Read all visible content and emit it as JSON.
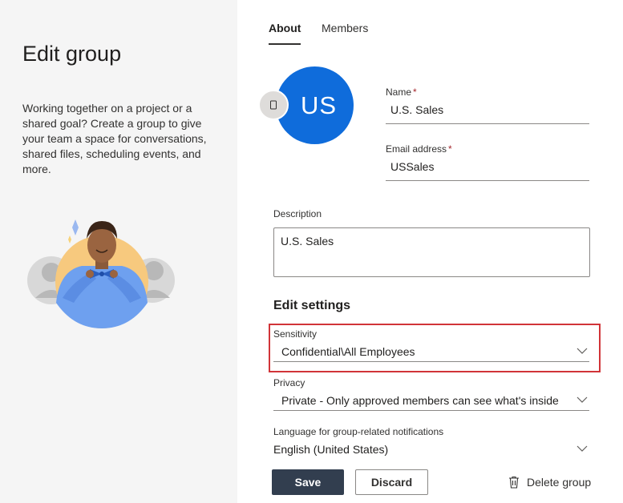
{
  "left": {
    "title": "Edit group",
    "description": "Working together on a project or a shared goal? Create a group to give your team a space for conversations, shared files, scheduling events, and more."
  },
  "tabs": [
    {
      "label": "About",
      "active": true
    },
    {
      "label": "Members",
      "active": false
    }
  ],
  "avatar": {
    "initials": "US",
    "color": "#0f6cdb",
    "edit_icon": "camera-icon"
  },
  "form": {
    "name": {
      "label": "Name",
      "required_mark": "*",
      "value": "U.S. Sales"
    },
    "email": {
      "label": "Email address",
      "required_mark": "*",
      "value": "USSales"
    },
    "description": {
      "label": "Description",
      "value": "U.S. Sales"
    }
  },
  "settings": {
    "title": "Edit settings",
    "sensitivity": {
      "label": "Sensitivity",
      "value": "Confidential\\All Employees"
    },
    "privacy": {
      "label": "Privacy",
      "value": "Private - Only approved members can see what's inside"
    },
    "language": {
      "label": "Language for group-related notifications",
      "value": "English (United States)"
    }
  },
  "footer": {
    "save_label": "Save",
    "discard_label": "Discard",
    "delete_label": "Delete group"
  },
  "colors": {
    "accent": "#0f6cdb",
    "primary_button": "#323e4f",
    "highlight": "#d13438",
    "required": "#a4262c"
  }
}
